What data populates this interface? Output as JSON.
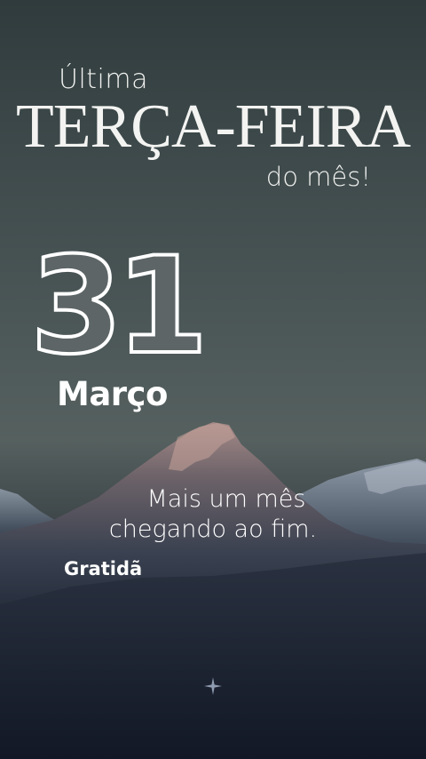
{
  "heading": {
    "line1": "Última",
    "line2": "TERÇA-FEIRA",
    "line3": "do mês!"
  },
  "date": {
    "day": "31",
    "month": "Março"
  },
  "message": {
    "line1": "Mais um mês",
    "line2": "chegando ao fim.",
    "gratitude": "Gratidã"
  },
  "icons": {
    "sparkle": "sparkle-icon"
  }
}
